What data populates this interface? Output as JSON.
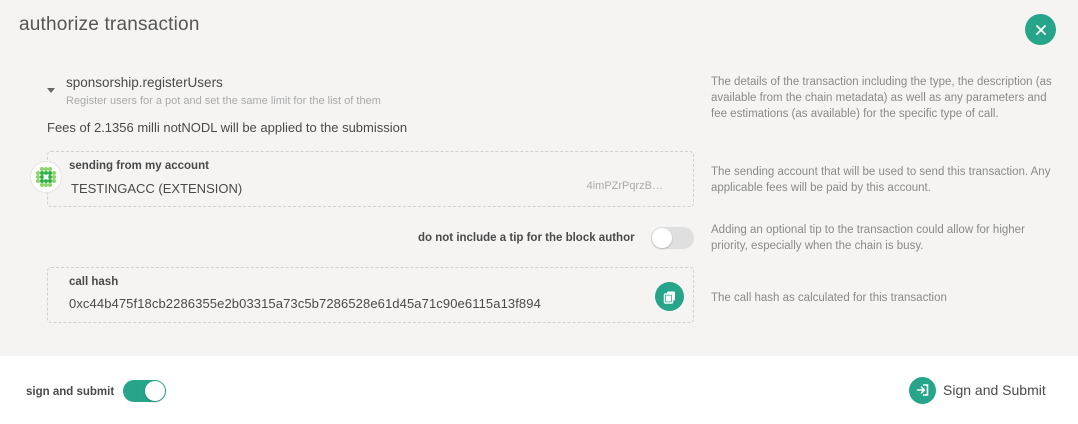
{
  "modal": {
    "title": "authorize transaction",
    "close_icon": "close-icon"
  },
  "call": {
    "method": "sponsorship.registerUsers",
    "description": "Register users for a pot and set the same limit for the list of them",
    "fees": "Fees of 2.1356 milli notNODL will be applied to the submission",
    "help": "The details of the transaction including the type, the description (as available from the chain metadata) as well as any parameters and fee estimations (as available) for the specific type of call."
  },
  "account": {
    "label": "sending from my account",
    "name": "TESTINGACC (EXTENSION)",
    "address": "4imPZrPqrzB…",
    "help": "The sending account that will be used to send this transaction. Any applicable fees will be paid by this account."
  },
  "tip": {
    "label": "do not include a tip for the block author",
    "enabled": false,
    "help": "Adding an optional tip to the transaction could allow for higher priority, especially when the chain is busy."
  },
  "callhash": {
    "label": "call hash",
    "value": "0xc44b475f18cb2286355e2b03315a73c5b7286528e61d45a71c90e6115a13f894",
    "help": "The call hash as calculated for this transaction",
    "copy_icon": "copy-icon"
  },
  "footer": {
    "sign_label": "sign and submit",
    "sign_enabled": true,
    "submit_label": "Sign and Submit",
    "submit_icon": "sign-in-icon"
  },
  "colors": {
    "accent": "#26a58a",
    "panel": "#f5f4f3"
  }
}
